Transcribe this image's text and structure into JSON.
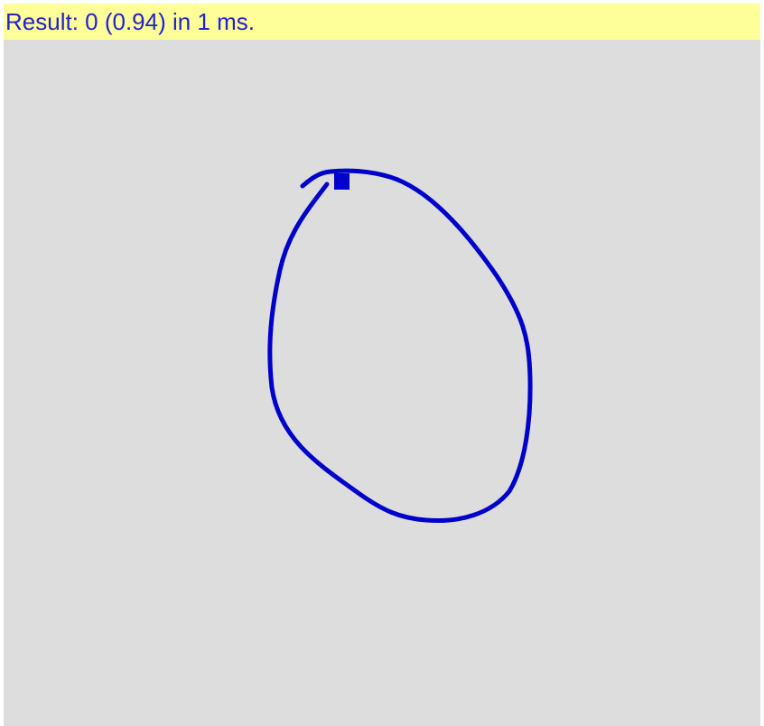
{
  "result_bar": {
    "text": "Result: 0 (0.94) in 1 ms."
  },
  "colors": {
    "stroke": "#0000cc",
    "canvas_bg": "#dddddd",
    "result_bg": "#ffff99",
    "result_text": "#2222cc"
  },
  "stroke_icon": "hand-drawn-zero-stroke",
  "cursor_icon": "stroke-end-square"
}
